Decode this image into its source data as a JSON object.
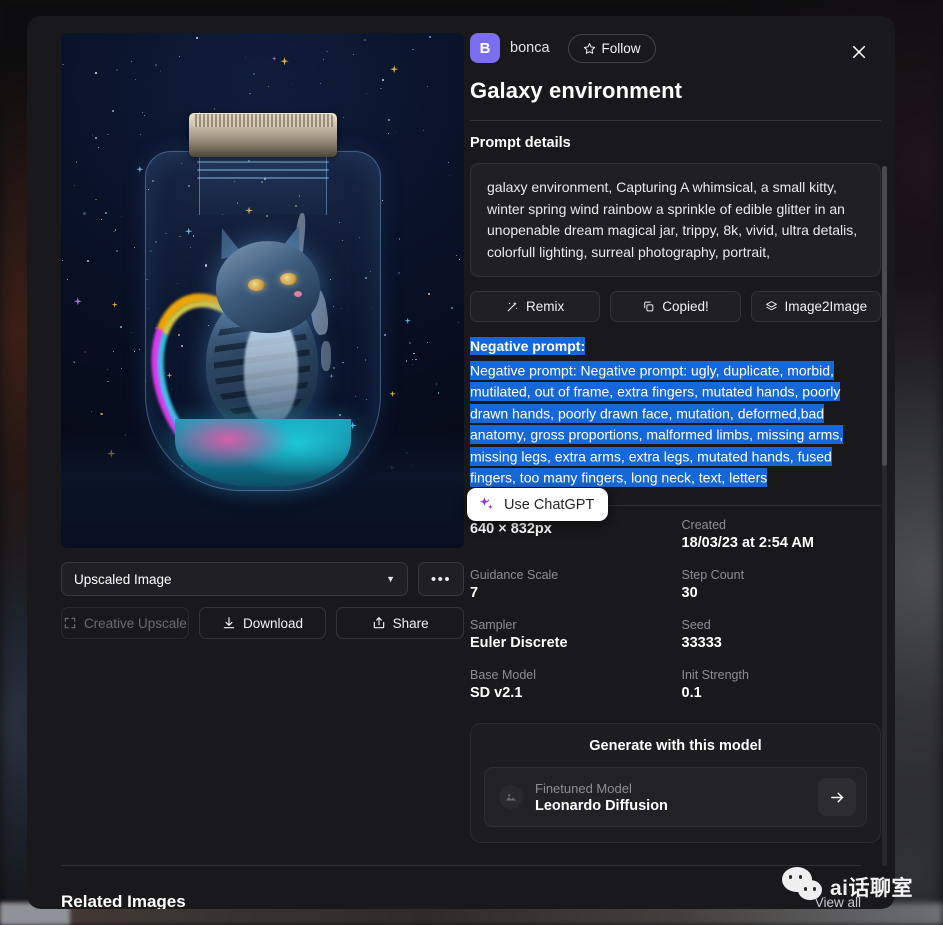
{
  "modal": {
    "close_label": "close-icon"
  },
  "author": {
    "avatar_initial": "B",
    "name": "bonca",
    "follow_label": "Follow"
  },
  "header": {
    "title": "Galaxy environment"
  },
  "prompt": {
    "section_label": "Prompt details",
    "text": "galaxy environment, Capturing A whimsical, a small kitty, winter spring wind rainbow a sprinkle of edible glitter in an unopenable dream magical jar, trippy, 8k, vivid, ultra detalis, colorfull lighting, surreal photography, portrait,",
    "actions": [
      {
        "label": "Remix",
        "icon": "wand-icon"
      },
      {
        "label": "Copied!",
        "icon": "copy-icon"
      },
      {
        "label": "Image2Image",
        "icon": "layers-icon"
      }
    ]
  },
  "negative_prompt": {
    "label": "Negative prompt:",
    "text": "Negative prompt: Negative prompt: ugly, duplicate, morbid, mutilated, out of frame, extra fingers, mutated hands, poorly drawn hands, poorly drawn face, mutation, deformed,bad anatomy, gross proportions, malformed limbs, missing arms, missing legs, extra arms, extra legs, mutated hands, fused fingers, too many fingers, long neck, text, letters",
    "selection_color": "#1668d8"
  },
  "chatgpt_popup": {
    "label": "Use ChatGPT",
    "icon": "sparkles-icon",
    "accent": "#8b2fd6"
  },
  "metadata": [
    {
      "label": "",
      "value": "640 × 832px"
    },
    {
      "label": "Created",
      "value": "18/03/23 at 2:54 AM"
    },
    {
      "label": "Guidance Scale",
      "value": "7"
    },
    {
      "label": "Step Count",
      "value": "30"
    },
    {
      "label": "Sampler",
      "value": "Euler Discrete"
    },
    {
      "label": "Seed",
      "value": "33333"
    },
    {
      "label": "Base Model",
      "value": "SD v2.1"
    },
    {
      "label": "Init Strength",
      "value": "0.1"
    }
  ],
  "generate_card": {
    "title": "Generate with this model",
    "model_sub": "Finetuned Model",
    "model_name": "Leonardo Diffusion",
    "go_icon": "arrow-right-icon"
  },
  "image_controls": {
    "select_value": "Upscaled Image",
    "more_label": "•••",
    "creative_upscale": "Creative Upscale",
    "download": "Download",
    "share": "Share"
  },
  "footer": {
    "related_title": "Related Images",
    "view_all": "View all"
  },
  "watermark": {
    "text": "ai话聊室"
  },
  "theme": {
    "modal_bg": "#19191b",
    "panel_bg": "#202023",
    "avatar_purple": "#7c6ef0",
    "selection_blue": "#1668d8"
  }
}
